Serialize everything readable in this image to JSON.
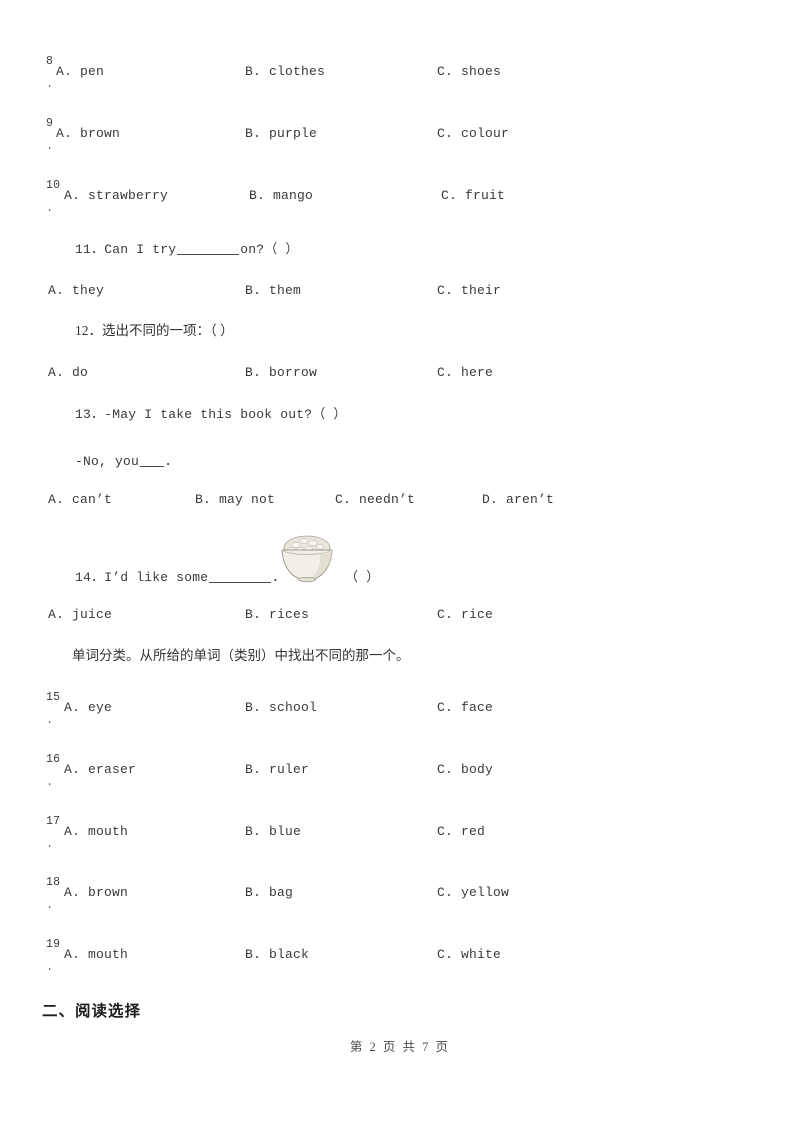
{
  "document": {
    "type": "exam-worksheet",
    "language": "zh-CN + en",
    "footer": "第 2 页 共 7 页"
  },
  "questions": [
    {
      "number": "8",
      "dot": ".",
      "digits": 1,
      "options": {
        "a": "A. pen",
        "b": "B. clothes",
        "c": "C. shoes"
      }
    },
    {
      "number": "9",
      "dot": ".",
      "digits": 1,
      "options": {
        "a": "A. brown",
        "b": "B. purple",
        "c": "C. colour"
      }
    },
    {
      "number": "10",
      "dot": ".",
      "digits": 2,
      "options": {
        "a": "A. strawberry",
        "b": "B. mango",
        "c": "C. fruit"
      }
    },
    {
      "number": "15",
      "dot": ".",
      "digits": 2,
      "options": {
        "a": "A. eye",
        "b": "B. school",
        "c": "C. face"
      }
    },
    {
      "number": "16",
      "dot": ".",
      "digits": 2,
      "options": {
        "a": "A. eraser",
        "b": "B. ruler",
        "c": "C. body"
      }
    },
    {
      "number": "17",
      "dot": ".",
      "digits": 2,
      "options": {
        "a": "A. mouth",
        "b": "B. blue",
        "c": "C. red"
      }
    },
    {
      "number": "18",
      "dot": ".",
      "digits": 2,
      "options": {
        "a": "A. brown",
        "b": "B. bag",
        "c": "C. yellow"
      }
    },
    {
      "number": "19",
      "dot": ".",
      "digits": 2,
      "options": {
        "a": "A. mouth",
        "b": "B. black",
        "c": "C. white"
      }
    }
  ],
  "q11": {
    "stem_prefix": "11．Can I try",
    "stem_suffix": "on?（    ）",
    "options": {
      "a": "A. they",
      "b": "B. them",
      "c": "C. their"
    }
  },
  "q12": {
    "stem": "12．选出不同的一项：（    ）",
    "options": {
      "a": "A. do",
      "b": "B. borrow",
      "c": "C. here"
    }
  },
  "q13": {
    "stem_line1": "13．-May I take this book out?（    ）",
    "stem_line2_prefix": "-No, you",
    "stem_line2_suffix": "．",
    "options": {
      "a": "A. can’t",
      "b": "B. may not",
      "c": "C. needn’t",
      "d": "D. aren’t"
    }
  },
  "q14": {
    "stem_prefix": "14．I’d like some",
    "stem_mid": "．",
    "stem_suffix": "（    ）",
    "image_alt": "bowl-of-rice",
    "options": {
      "a": "A. juice",
      "b": "B. rices",
      "c": "C. rice"
    }
  },
  "instruction": {
    "text": "单词分类。从所给的单词（类别）中找出不同的那一个。"
  },
  "section2": {
    "heading": "二、阅读选择"
  },
  "colors": {
    "text": "#3a3a3a",
    "heading": "#1d1d1d",
    "rule": "#4a4a4a",
    "background": "#ffffff",
    "bowl_light": "#efece4",
    "bowl_mid": "#d8d4c8",
    "bowl_dark": "#b4b0a4"
  }
}
